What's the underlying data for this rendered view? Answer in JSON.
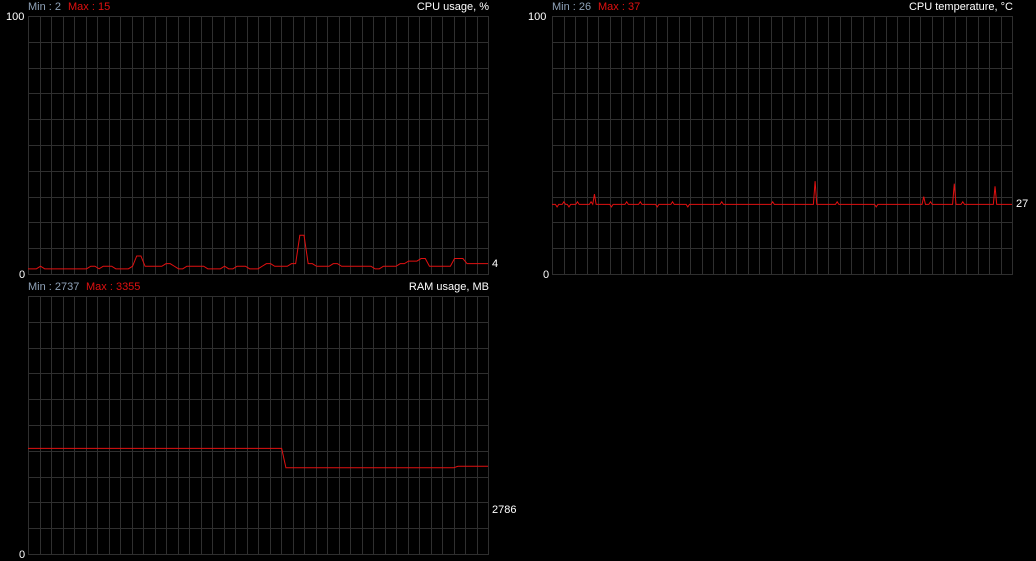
{
  "colors": {
    "background": "#000000",
    "grid": "#2f2f2f",
    "line": "#e01010",
    "min_label": "#8fa2b8",
    "max_label": "#e01010",
    "text": "#ffffff"
  },
  "graphs": [
    {
      "min_text": "Min : 2",
      "max_text": "Max : 15",
      "title": "CPU usage, %",
      "y_max_label": "100",
      "y_min_label": "0",
      "current": "4",
      "chart_data": {
        "type": "line",
        "ylim": [
          0,
          100
        ],
        "values": [
          2,
          2,
          2,
          3,
          2,
          2,
          2,
          2,
          2,
          2,
          2,
          2,
          2,
          2,
          2,
          3,
          3,
          2,
          3,
          3,
          3,
          2,
          2,
          2,
          2,
          3,
          7,
          7,
          3,
          3,
          3,
          3,
          3,
          4,
          4,
          3,
          2,
          2,
          3,
          3,
          3,
          3,
          3,
          2,
          2,
          2,
          2,
          3,
          2,
          2,
          3,
          3,
          3,
          2,
          2,
          2,
          3,
          4,
          4,
          3,
          3,
          3,
          3,
          4,
          4,
          15,
          15,
          4,
          4,
          3,
          3,
          3,
          3,
          4,
          4,
          3,
          3,
          3,
          3,
          3,
          3,
          3,
          3,
          2,
          2,
          3,
          3,
          3,
          3,
          4,
          4,
          5,
          5,
          5,
          6,
          6,
          3,
          3,
          3,
          3,
          3,
          3,
          6,
          6,
          6,
          4,
          4,
          4,
          4,
          4,
          4
        ]
      }
    },
    {
      "min_text": "Min : 26",
      "max_text": "Max : 37",
      "title": "CPU temperature, °C",
      "y_max_label": "100",
      "y_min_label": "0",
      "current": "27",
      "chart_data": {
        "type": "line",
        "ylim": [
          0,
          100
        ],
        "values": [
          27,
          27,
          27,
          26,
          27,
          27,
          27,
          28,
          27,
          27,
          26,
          27,
          27,
          27,
          27,
          28,
          27,
          27,
          27,
          27,
          27,
          27,
          27,
          28,
          27,
          31,
          27,
          27,
          27,
          27,
          27,
          27,
          27,
          27,
          27,
          26,
          27,
          27,
          27,
          27,
          27,
          27,
          27,
          27,
          28,
          27,
          27,
          27,
          27,
          27,
          27,
          27,
          28,
          27,
          27,
          27,
          27,
          27,
          27,
          27,
          27,
          27,
          26,
          27,
          27,
          27,
          27,
          27,
          27,
          27,
          27,
          28,
          27,
          27,
          27,
          27,
          27,
          27,
          27,
          27,
          26,
          27,
          27,
          27,
          27,
          27,
          27,
          27,
          27,
          27,
          27,
          27,
          27,
          27,
          27,
          27,
          27,
          27,
          27,
          27,
          28,
          27,
          27,
          27,
          27,
          27,
          27,
          27,
          27,
          27,
          27,
          27,
          27,
          27,
          27,
          27,
          27,
          27,
          27,
          27,
          27,
          27,
          27,
          27,
          27,
          27,
          27,
          27,
          27,
          27,
          28,
          27,
          27,
          27,
          27,
          27,
          27,
          27,
          27,
          27,
          27,
          27,
          27,
          27,
          27,
          27,
          27,
          27,
          27,
          27,
          27,
          27,
          27,
          27,
          27,
          36,
          27,
          27,
          27,
          27,
          27,
          27,
          27,
          27,
          27,
          27,
          27,
          27,
          28,
          27,
          27,
          27,
          27,
          27,
          27,
          27,
          27,
          27,
          27,
          27,
          27,
          27,
          27,
          27,
          27,
          27,
          27,
          27,
          27,
          27,
          27,
          26,
          27,
          27,
          27,
          27,
          27,
          27,
          27,
          27,
          27,
          27,
          27,
          27,
          27,
          27,
          27,
          27,
          27,
          27,
          27,
          27,
          27,
          27,
          27,
          27,
          27,
          27,
          27,
          30,
          27,
          27,
          27,
          28,
          27,
          27,
          27,
          27,
          27,
          27,
          27,
          27,
          27,
          27,
          27,
          27,
          27,
          35,
          27,
          27,
          27,
          27,
          28,
          27,
          27,
          27,
          27,
          27,
          27,
          27,
          27,
          27,
          27,
          27,
          27,
          27,
          27,
          27,
          27,
          27,
          27,
          34,
          27,
          27,
          27,
          27,
          27,
          27,
          27,
          27,
          27,
          27
        ]
      }
    },
    {
      "min_text": "Min : 2737",
      "max_text": "Max : 3355",
      "title": "RAM usage, MB",
      "y_max_label": "",
      "y_min_label": "0",
      "current": "2786",
      "chart_data": {
        "type": "line",
        "ylim": [
          0,
          8192
        ],
        "values": [
          3355,
          3355,
          3355,
          3355,
          3355,
          3355,
          3355,
          3355,
          3355,
          3355,
          3355,
          3355,
          3355,
          3355,
          3355,
          3355,
          3355,
          3355,
          3355,
          3355,
          3355,
          3355,
          3355,
          3355,
          3355,
          3355,
          3355,
          3355,
          3355,
          3355,
          3355,
          3355,
          3355,
          3355,
          3355,
          3355,
          3355,
          3355,
          3355,
          3355,
          3355,
          3355,
          3355,
          3355,
          3355,
          3355,
          3355,
          3355,
          3355,
          3355,
          3355,
          3355,
          3355,
          3355,
          3355,
          3355,
          3355,
          3355,
          3355,
          3355,
          2737,
          2737,
          2737,
          2737,
          2737,
          2737,
          2737,
          2737,
          2737,
          2737,
          2737,
          2737,
          2737,
          2737,
          2737,
          2737,
          2737,
          2737,
          2737,
          2737,
          2737,
          2737,
          2737,
          2737,
          2737,
          2737,
          2737,
          2737,
          2737,
          2737,
          2737,
          2737,
          2737,
          2737,
          2737,
          2737,
          2737,
          2737,
          2737,
          2737,
          2786,
          2786,
          2786,
          2786,
          2786,
          2786,
          2786,
          2786
        ]
      }
    }
  ]
}
